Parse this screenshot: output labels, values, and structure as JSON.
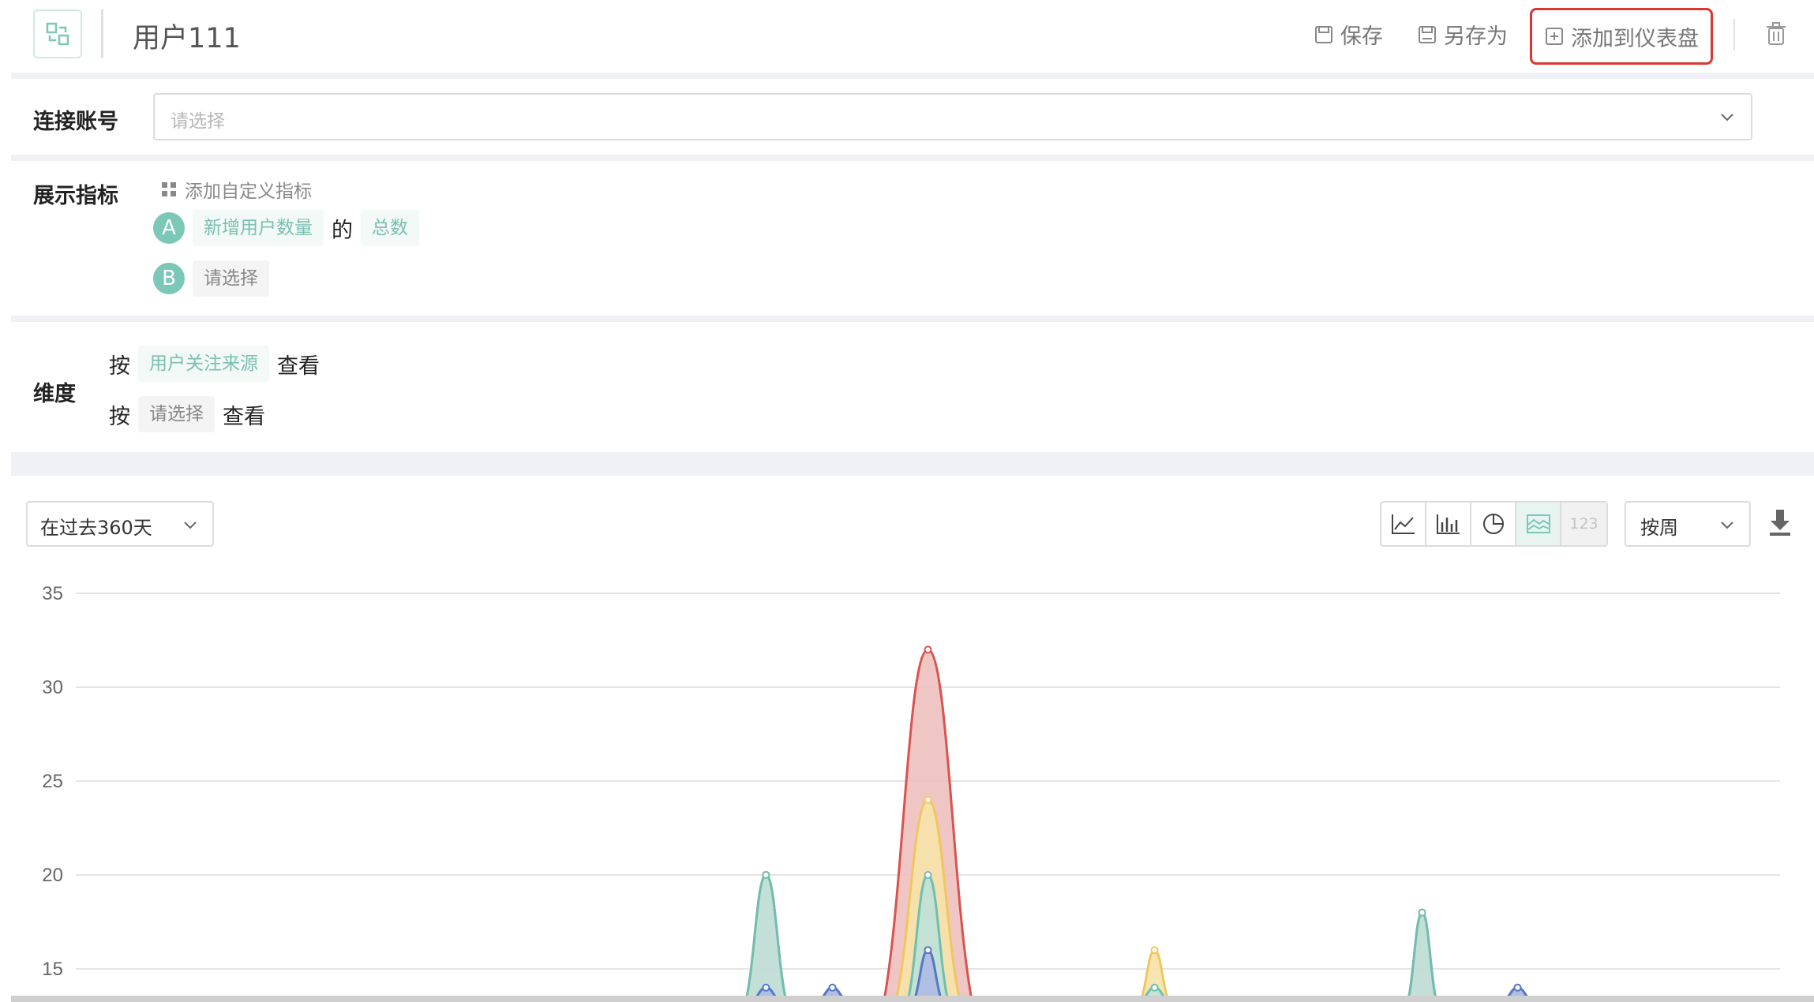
{
  "header": {
    "title": "用户111",
    "save_label": "保存",
    "save_as_label": "另存为",
    "add_to_dashboard_label": "添加到仪表盘"
  },
  "account": {
    "label": "连接账号",
    "placeholder": "请选择"
  },
  "metrics": {
    "label": "展示指标",
    "add_custom_label": "添加自定义指标",
    "items": [
      {
        "letter": "A",
        "field": "新增用户数量",
        "connector": "的",
        "agg": "总数"
      },
      {
        "letter": "B",
        "field": "请选择"
      }
    ]
  },
  "dimension": {
    "label": "维度",
    "rows": [
      {
        "prefix": "按",
        "value": "用户关注来源",
        "suffix": "查看"
      },
      {
        "prefix": "按",
        "value": "请选择",
        "suffix": "查看"
      }
    ]
  },
  "toolbar": {
    "range": "在过去360天",
    "chart_types": [
      "line-chart-icon",
      "bar-chart-icon",
      "pie-chart-icon",
      "area-chart-icon",
      "number-icon"
    ],
    "number_label": "123",
    "active_type": "area",
    "granularity": "按周"
  },
  "colors": {
    "accent": "#7bc8b8",
    "highlight_border": "#d9382f",
    "series_red": "#d9534f",
    "series_yellow": "#f0c75e",
    "series_teal": "#6fbfae",
    "series_blue": "#5479c6"
  },
  "chart_data": {
    "type": "area",
    "y_ticks": [
      "35",
      "30",
      "25",
      "20",
      "15"
    ],
    "ylim": [
      15,
      35
    ],
    "grid": true,
    "peaks": [
      {
        "x": 0.405,
        "values": {
          "red": 20,
          "teal": 20,
          "blue": 14
        }
      },
      {
        "x": 0.444,
        "values": {
          "red": 14,
          "blue": 14
        }
      },
      {
        "x": 0.5,
        "values": {
          "red": 32,
          "yellow": 24,
          "teal": 20,
          "orange": 16,
          "blue": 16
        }
      },
      {
        "x": 0.633,
        "values": {
          "yellow": 16,
          "teal": 14
        }
      },
      {
        "x": 0.79,
        "values": {
          "red": 18,
          "teal": 18
        }
      },
      {
        "x": 0.846,
        "values": {
          "red": 14,
          "blue": 14
        }
      }
    ]
  }
}
